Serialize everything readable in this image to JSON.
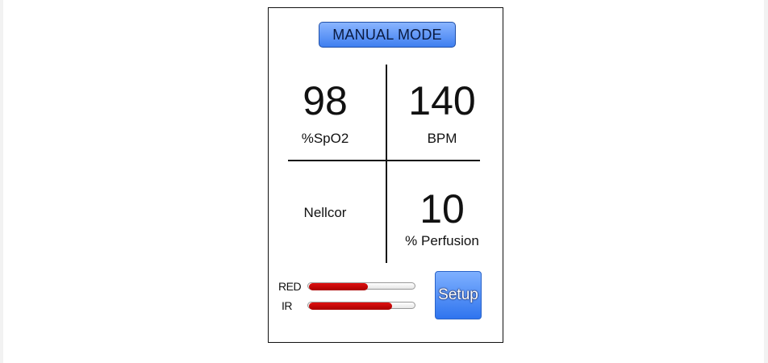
{
  "mode_button": {
    "label": "MANUAL MODE"
  },
  "spo2": {
    "value": "98",
    "unit": "%SpO2"
  },
  "pulse": {
    "value": "140",
    "unit": "BPM"
  },
  "sensor": {
    "brand": "Nellcor"
  },
  "perfusion": {
    "value": "10",
    "unit": "% Perfusion"
  },
  "signal_bars": [
    {
      "label": "RED",
      "level": 0.55
    },
    {
      "label": "IR",
      "level": 0.78
    }
  ],
  "setup_button": {
    "label": "Setup"
  },
  "colors": {
    "button_blue": "#3f7ff0",
    "bar_red": "#c00000"
  }
}
